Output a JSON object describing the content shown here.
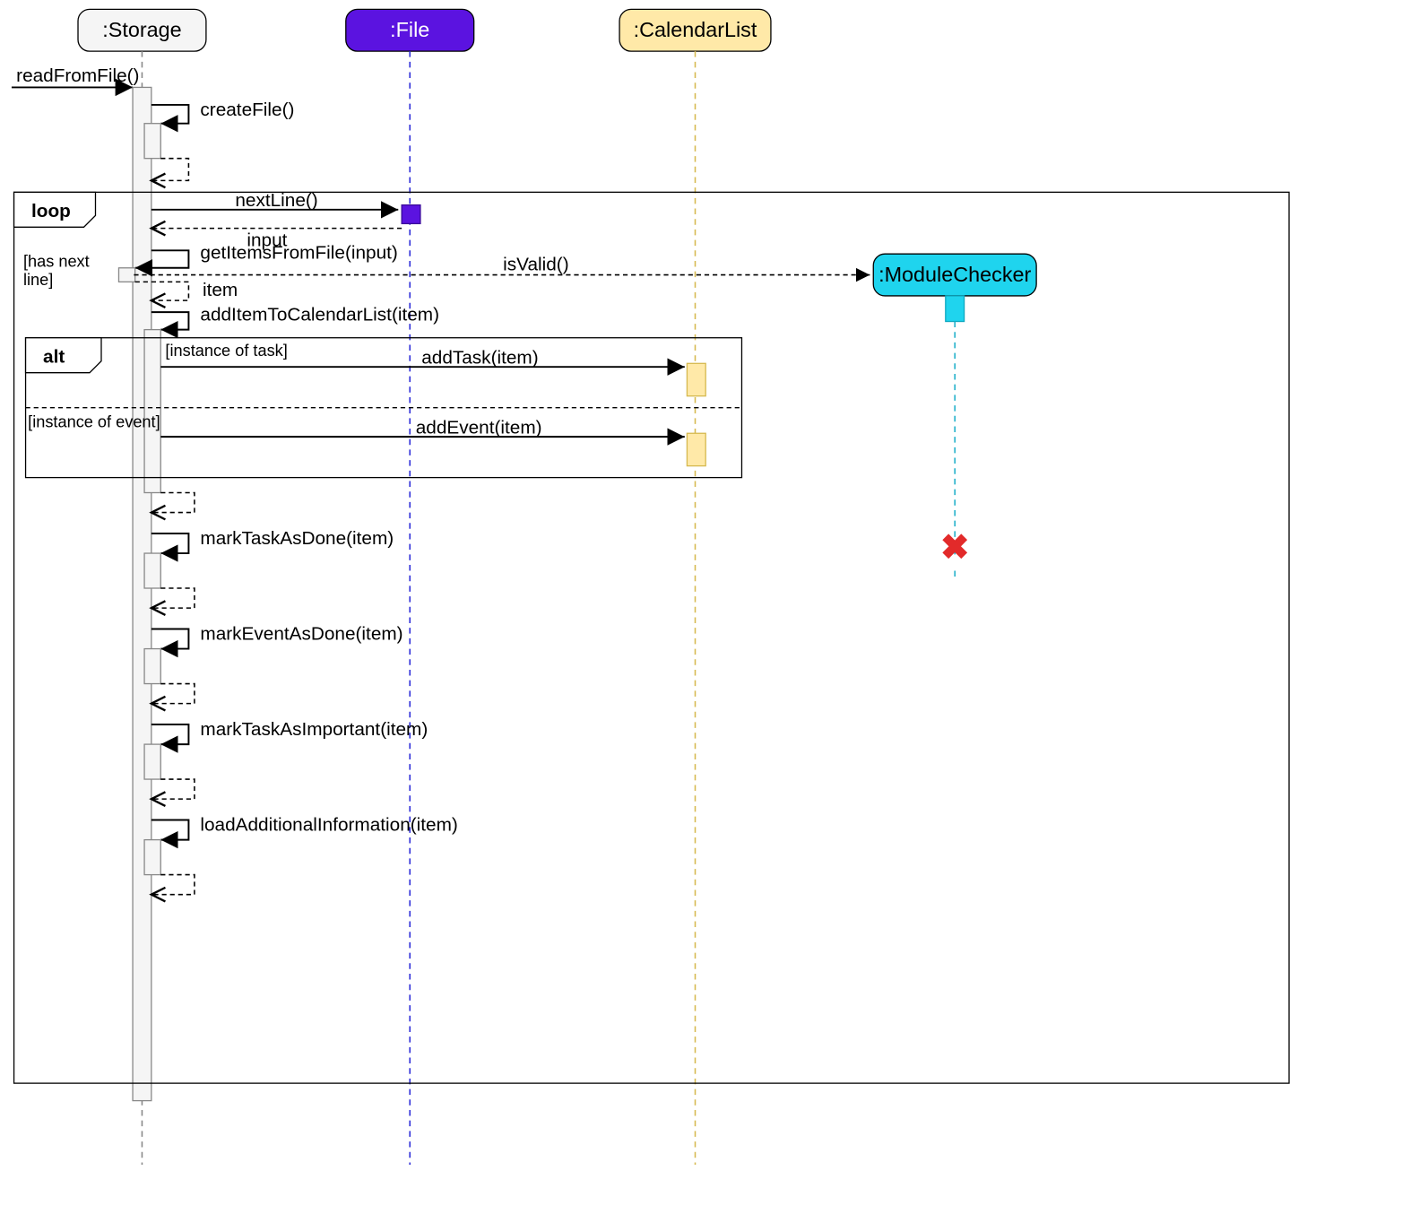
{
  "participants": {
    "storage": {
      "label": ":Storage",
      "fill": "#f5f5f5",
      "stroke": "#888888"
    },
    "file": {
      "label": ":File",
      "fill": "#5b13e0",
      "stroke": "#3a0b99",
      "text": "#ffffff",
      "lifeline_color": "#2b2bd8"
    },
    "calendarlist": {
      "label": ":CalendarList",
      "fill": "#ffe9a8",
      "stroke": "#d6b94f",
      "lifeline_color": "#d6b94f"
    },
    "modulechecker": {
      "label": ":ModuleChecker",
      "fill": "#1fd4ee",
      "stroke": "#0ea8c0",
      "lifeline_color": "#1fb0c9"
    }
  },
  "messages": {
    "readFromFile": "readFromFile()",
    "createFile": "createFile()",
    "nextLine": "nextLine()",
    "input": "input",
    "getItemsFromFile": "getItemsFromFile(input)",
    "isValid": "isValid()",
    "item": "item",
    "addItemToCalendarList": "addItemToCalendarList(item)",
    "addTask": "addTask(item)",
    "addEvent": "addEvent(item)",
    "markTaskAsDone": "markTaskAsDone(item)",
    "markEventAsDone": "markEventAsDone(item)",
    "markTaskAsImportant": "markTaskAsImportant(item)",
    "loadAdditionalInformation": "loadAdditionalInformation(item)"
  },
  "fragments": {
    "loop": {
      "label": "loop",
      "guard": "[has next line]"
    },
    "alt": {
      "label": "alt",
      "guard1": "[instance of task]",
      "guard2": "[instance of event]"
    }
  },
  "destruction_x": "X"
}
